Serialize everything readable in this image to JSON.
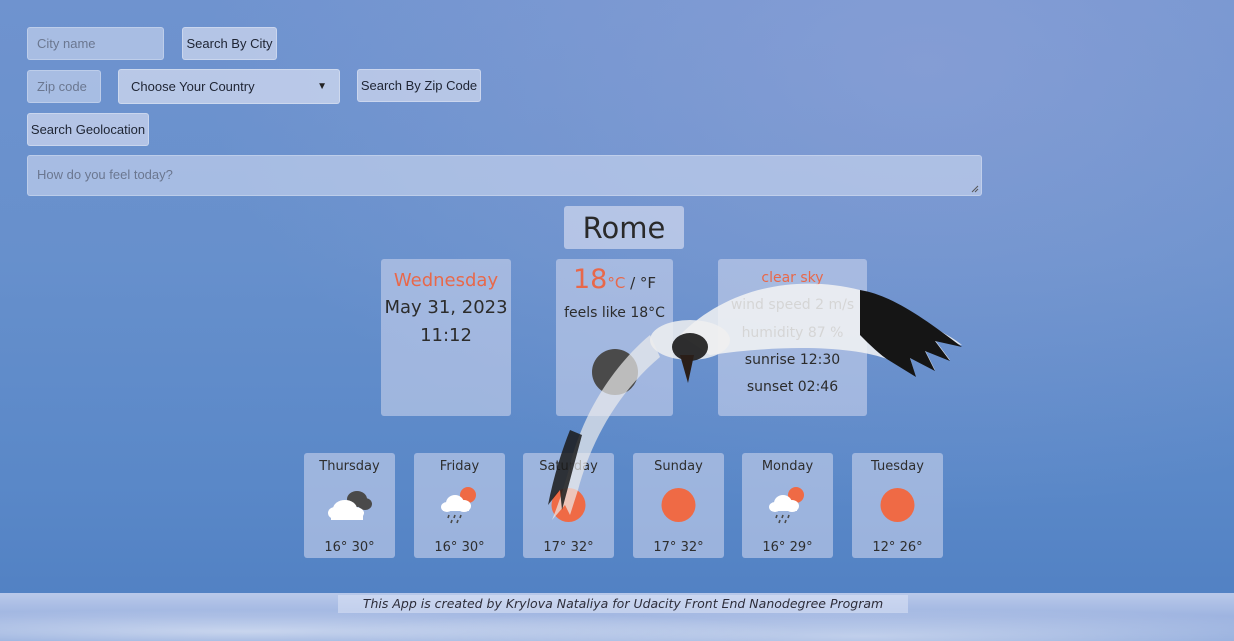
{
  "search": {
    "city_placeholder": "City name",
    "city_button": "Search By City",
    "zip_placeholder": "Zip code",
    "country_selected": "Choose Your Country",
    "zip_button": "Search By Zip Code",
    "geo_button": "Search Geolocation",
    "feelings_placeholder": "How do you feel today?"
  },
  "current": {
    "city": "Rome",
    "day": "Wednesday",
    "date": "May 31, 2023",
    "time": "11:12",
    "temp": "18",
    "unit_c": "°C",
    "unit_sep": " / ",
    "unit_f": "°F",
    "feels_like": "feels like 18°C",
    "description": "clear sky",
    "wind_label": "wind speed ",
    "wind_value": "2 m/s",
    "humidity_label": "humidity ",
    "humidity_value": "87 %",
    "sunrise_label": "sunrise ",
    "sunrise_value": "12:30",
    "sunset_label": "sunset ",
    "sunset_value": "02:46"
  },
  "forecast": [
    {
      "day": "Thursday",
      "temps": "16° 30°",
      "icon": "cloud-icon"
    },
    {
      "day": "Friday",
      "temps": "16° 30°",
      "icon": "rain-sun-icon"
    },
    {
      "day": "Saturday",
      "temps": "17° 32°",
      "icon": "sun-icon"
    },
    {
      "day": "Sunday",
      "temps": "17° 32°",
      "icon": "sun-icon"
    },
    {
      "day": "Monday",
      "temps": "16° 29°",
      "icon": "rain-sun-icon"
    },
    {
      "day": "Tuesday",
      "temps": "12° 26°",
      "icon": "sun-icon"
    }
  ],
  "footer": {
    "credit": "This App is created by Krylova Nataliya for Udacity Front End Nanodegree Program"
  },
  "colors": {
    "accent": "#e8684a",
    "sun": "#ef6a45"
  }
}
